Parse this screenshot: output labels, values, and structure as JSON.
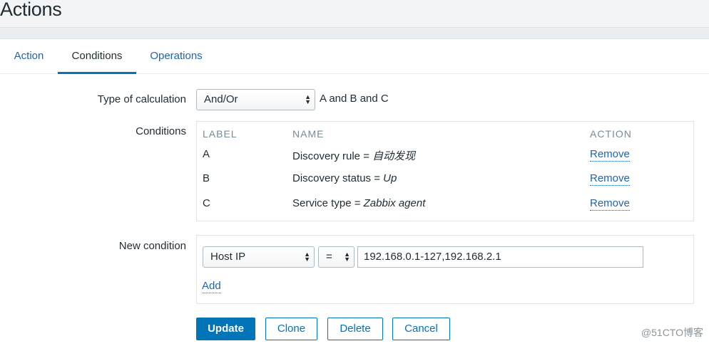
{
  "page": {
    "title": "Actions"
  },
  "tabs": [
    {
      "label": "Action",
      "active": false
    },
    {
      "label": "Conditions",
      "active": true
    },
    {
      "label": "Operations",
      "active": false
    }
  ],
  "calculation": {
    "label": "Type of calculation",
    "value": "And/Or",
    "formula": "A and B and C"
  },
  "conditions": {
    "label": "Conditions",
    "headers": {
      "label": "LABEL",
      "name": "NAME",
      "action": "ACTION"
    },
    "rows": [
      {
        "label": "A",
        "name_prefix": "Discovery rule = ",
        "name_value": "自动发现",
        "action": "Remove"
      },
      {
        "label": "B",
        "name_prefix": "Discovery status = ",
        "name_value": "Up",
        "action": "Remove"
      },
      {
        "label": "C",
        "name_prefix": "Service type = ",
        "name_value": "Zabbix agent",
        "action": "Remove"
      }
    ]
  },
  "new_condition": {
    "label": "New condition",
    "type_value": "Host IP",
    "operator_value": "=",
    "value": "192.168.0.1-127,192.168.2.1",
    "add_label": "Add"
  },
  "buttons": {
    "update": "Update",
    "clone": "Clone",
    "delete": "Delete",
    "cancel": "Cancel"
  },
  "watermark": "@51CTO博客",
  "colors": {
    "accent": "#0275b8",
    "link": "#1f65ad",
    "background": "#ebeef0"
  }
}
